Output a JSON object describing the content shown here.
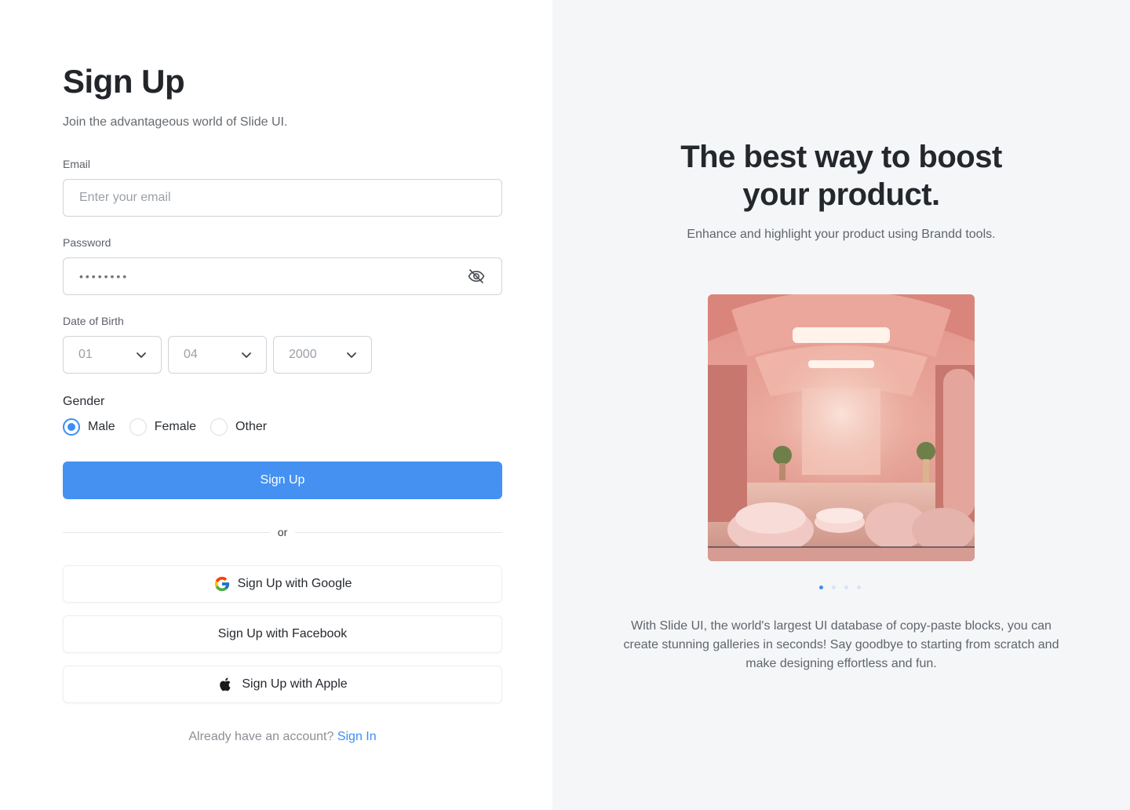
{
  "form": {
    "title": "Sign Up",
    "subtitle": "Join the advantageous world of Slide UI.",
    "email": {
      "label": "Email",
      "placeholder": "Enter your email"
    },
    "password": {
      "label": "Password",
      "value": "••••••••"
    },
    "dob": {
      "label": "Date of Birth",
      "day": "01",
      "month": "04",
      "year": "2000"
    },
    "gender": {
      "label": "Gender",
      "options": [
        "Male",
        "Female",
        "Other"
      ],
      "selected": "Male"
    },
    "submit_label": "Sign Up",
    "divider_text": "or",
    "social": {
      "google": "Sign Up with Google",
      "facebook": "Sign Up with Facebook",
      "apple": "Sign Up with Apple"
    },
    "footer": {
      "prompt": "Already have an account?",
      "link": "Sign In"
    }
  },
  "hero": {
    "title_line1": "The best way to boost",
    "title_line2": "your product.",
    "subtitle": "Enhance and highlight your product using Brandd tools.",
    "carousel": {
      "count": 4,
      "active": 1
    },
    "description": "With Slide UI, the world's largest UI database of copy-paste blocks, you can create stunning galleries in seconds! Say goodbye to starting from scratch and make designing effortless and fun."
  },
  "colors": {
    "accent": "#4491f2",
    "link": "#3b8ef5",
    "right_panel_bg": "#f5f6f8"
  }
}
